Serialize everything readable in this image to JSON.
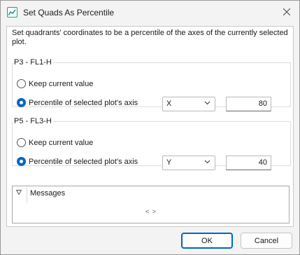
{
  "window": {
    "title": "Set Quads As Percentile",
    "close_icon": "close-icon",
    "app_icon": "chart-icon"
  },
  "description": "Set quadrants' coordinates to be a percentile of the axes of the currently selected plot.",
  "groups": [
    {
      "legend": "P3 - FL1-H",
      "keep_label": "Keep current value",
      "percentile_label": "Percentile of selected plot's axis",
      "selected_option": "percentile",
      "axis_value": "X",
      "percentile_value": "80"
    },
    {
      "legend": "P5 - FL3-H",
      "keep_label": "Keep current value",
      "percentile_label": "Percentile of selected plot's axis",
      "selected_option": "percentile",
      "axis_value": "Y",
      "percentile_value": "40"
    }
  ],
  "messages": {
    "label": "Messages",
    "expand_icon": "triangle-down-icon",
    "nav_text": "< >"
  },
  "buttons": {
    "ok": "OK",
    "cancel": "Cancel"
  }
}
